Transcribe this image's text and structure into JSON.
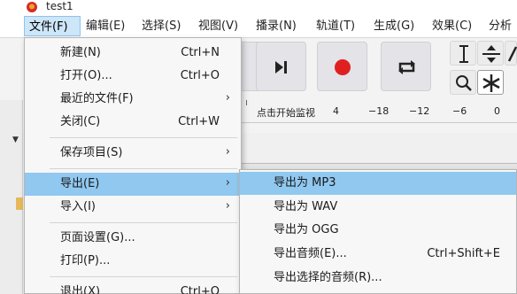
{
  "window": {
    "title": "test1"
  },
  "menubar": {
    "items": [
      {
        "label": "文件(F)",
        "active": true
      },
      {
        "label": "编辑(E)"
      },
      {
        "label": "选择(S)"
      },
      {
        "label": "视图(V)"
      },
      {
        "label": "播录(N)"
      },
      {
        "label": "轨道(T)"
      },
      {
        "label": "生成(G)"
      },
      {
        "label": "效果(C)"
      },
      {
        "label": "分析"
      }
    ]
  },
  "toolbar": {
    "buttons": [
      {
        "icon": "skip-to-end-icon"
      },
      {
        "icon": "record-icon",
        "color": "#e02020"
      },
      {
        "icon": "loop-icon"
      }
    ],
    "tools": [
      {
        "icon": "selection-tool-icon"
      },
      {
        "icon": "envelope-tool-icon"
      },
      {
        "icon": "draw-tool-icon"
      },
      {
        "icon": "zoom-tool-icon"
      },
      {
        "icon": "multi-tool-icon",
        "selected": true
      }
    ]
  },
  "meter": {
    "monitor_label": "点击开始监视",
    "ticks": [
      "4",
      "−18",
      "−12",
      "−6",
      "0"
    ]
  },
  "file_menu": {
    "items": [
      {
        "label": "新建(N)",
        "shortcut": "Ctrl+N"
      },
      {
        "label": "打开(O)...",
        "shortcut": "Ctrl+O"
      },
      {
        "label": "最近的文件(F)",
        "submenu": true
      },
      {
        "label": "关闭(C)",
        "shortcut": "Ctrl+W"
      },
      {
        "label": "保存项目(S)",
        "submenu": true
      },
      {
        "label": "导出(E)",
        "submenu": true,
        "highlighted": true
      },
      {
        "label": "导入(I)",
        "submenu": true
      },
      {
        "label": "页面设置(G)..."
      },
      {
        "label": "打印(P)..."
      },
      {
        "label": "退出(X)",
        "shortcut": "Ctrl+Q"
      }
    ]
  },
  "export_menu": {
    "items": [
      {
        "label": "导出为 MP3",
        "highlighted": true
      },
      {
        "label": "导出为 WAV"
      },
      {
        "label": "导出为 OGG"
      },
      {
        "label": "导出音频(E)...",
        "shortcut": "Ctrl+Shift+E"
      },
      {
        "label": "导出选择的音频(R)..."
      }
    ]
  },
  "colors": {
    "menu_highlight": "#90c8f0",
    "menubar_active": "#cde6f8",
    "record": "#e02020"
  }
}
